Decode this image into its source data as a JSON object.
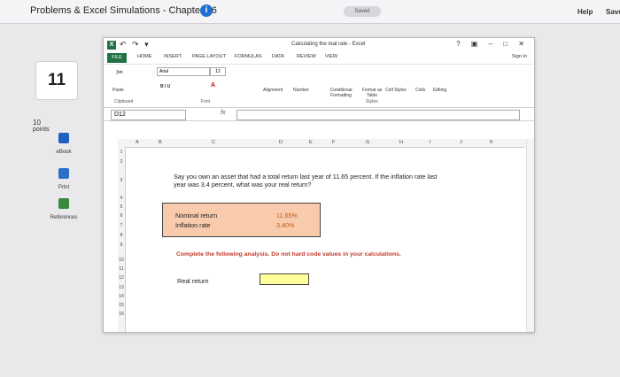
{
  "topbar": {
    "title": "Problems & Excel Simulations - Chapter 06",
    "saved": "Saved",
    "help": "Help",
    "save": "Save"
  },
  "left": {
    "question_number": "11",
    "points_value": "10",
    "points_label": "points",
    "nav": [
      {
        "label": "eBook",
        "icon": "ebook-icon"
      },
      {
        "label": "Print",
        "icon": "print-icon"
      },
      {
        "label": "References",
        "icon": "references-icon"
      }
    ]
  },
  "excel": {
    "window_title": "Calculating the real rate - Excel",
    "quick_access": "↶ ↷ ▾",
    "window_buttons": "? ▣ – □ ✕",
    "tabs": [
      "FILE",
      "HOME",
      "INSERT",
      "PAGE LAYOUT",
      "FORMULAS",
      "DATA",
      "REVIEW",
      "VIEW"
    ],
    "sign_in": "Sign In",
    "ribbon": {
      "paste": "Paste",
      "font_name": "Arial",
      "font_size": "12",
      "bold_italic_underline": "B I U",
      "alignment": "Alignment",
      "number": "Number",
      "conditional": "Conditional Formatting",
      "format_as_table": "Format as Table",
      "cell_styles": "Cell Styles",
      "cells": "Cells",
      "editing": "Editing",
      "clipboard_group": "Clipboard",
      "font_group": "Font",
      "styles_group": "Styles"
    },
    "name_box": "D12",
    "fx": "fx",
    "columns": [
      "A",
      "B",
      "C",
      "D",
      "E",
      "F",
      "G",
      "H",
      "I",
      "J",
      "K"
    ],
    "rows": [
      "1",
      "2",
      "3",
      "4",
      "5",
      "6",
      "7",
      "8",
      "9",
      "10",
      "11",
      "12",
      "13",
      "14",
      "15",
      "16"
    ],
    "question_text": "Say you own an asset that had a total return last year of 11.65 percent. If the inflation rate last year was 3.4 percent, what was your real return?",
    "inputs": [
      {
        "label": "Nominal return",
        "value": "11.65%"
      },
      {
        "label": "Inflation rate",
        "value": "3.40%"
      }
    ],
    "instruction": "Complete the following analysis. Do not hard code values in your calculations.",
    "output_label": "Real return",
    "output_value": ""
  }
}
